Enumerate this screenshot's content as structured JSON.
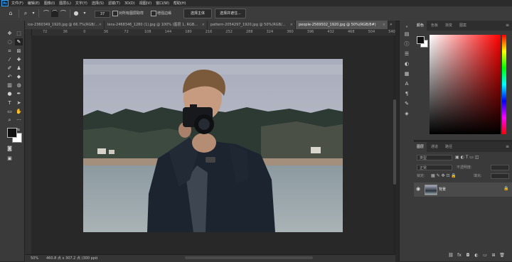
{
  "app": {
    "logo": "Ps"
  },
  "menu": [
    "文件(F)",
    "编辑(E)",
    "图像(I)",
    "图层(L)",
    "文字(Y)",
    "选择(S)",
    "滤镜(T)",
    "3D(D)",
    "视图(V)",
    "窗口(W)",
    "帮助(H)"
  ],
  "options": {
    "brush_size": "37",
    "sample_all_layers": "对所有图层取样",
    "enhance_edge": "增强边缘",
    "select_subject": "选择主体",
    "select_and_mask": "选择并遮住..."
  },
  "tabs": [
    {
      "label": "ice-2360349_1920.jpg @ 66.7%(RGB/...",
      "active": false
    },
    {
      "label": "lens-2468346_1280 (1).jpg @ 100% (图层 1, RGB...",
      "active": false
    },
    {
      "label": "pattern-2054297_1920.jpg @ 50%(RGB/...",
      "active": false
    },
    {
      "label": "people-2569502_1920.jpg @ 50%(RGB/8#)",
      "active": true
    }
  ],
  "ruler_ticks": [
    "72",
    "36",
    "0",
    "36",
    "72",
    "108",
    "144",
    "180",
    "216",
    "252",
    "288",
    "324",
    "360",
    "396",
    "432",
    "468",
    "504",
    "540"
  ],
  "status": {
    "zoom": "50%",
    "doc_info": "460.8 点 x 307.2 点 (300 ppi)"
  },
  "color_panel": {
    "tabs": [
      "颜色",
      "色板",
      "渐变",
      "图案"
    ],
    "accent_hue": "#ff0000"
  },
  "layers_panel": {
    "tabs": [
      "图层",
      "通道",
      "路径"
    ],
    "kind_placeholder": "类型",
    "blend_mode": "正常",
    "opacity_label": "不透明度:",
    "lock_label": "锁定:",
    "fill_label": "填充:",
    "layer_name": "背景"
  },
  "icons": {
    "tools": [
      "move-icon",
      "marquee-icon",
      "lasso-icon",
      "quick-select-icon",
      "crop-icon",
      "frame-icon",
      "eyedropper-icon",
      "heal-icon",
      "brush-icon",
      "stamp-icon",
      "history-brush-icon",
      "eraser-icon",
      "gradient-icon",
      "blur-icon",
      "dodge-icon",
      "pen-icon",
      "type-icon",
      "path-select-icon",
      "shape-icon",
      "hand-icon",
      "zoom-icon",
      "edit-toolbar-icon"
    ]
  }
}
